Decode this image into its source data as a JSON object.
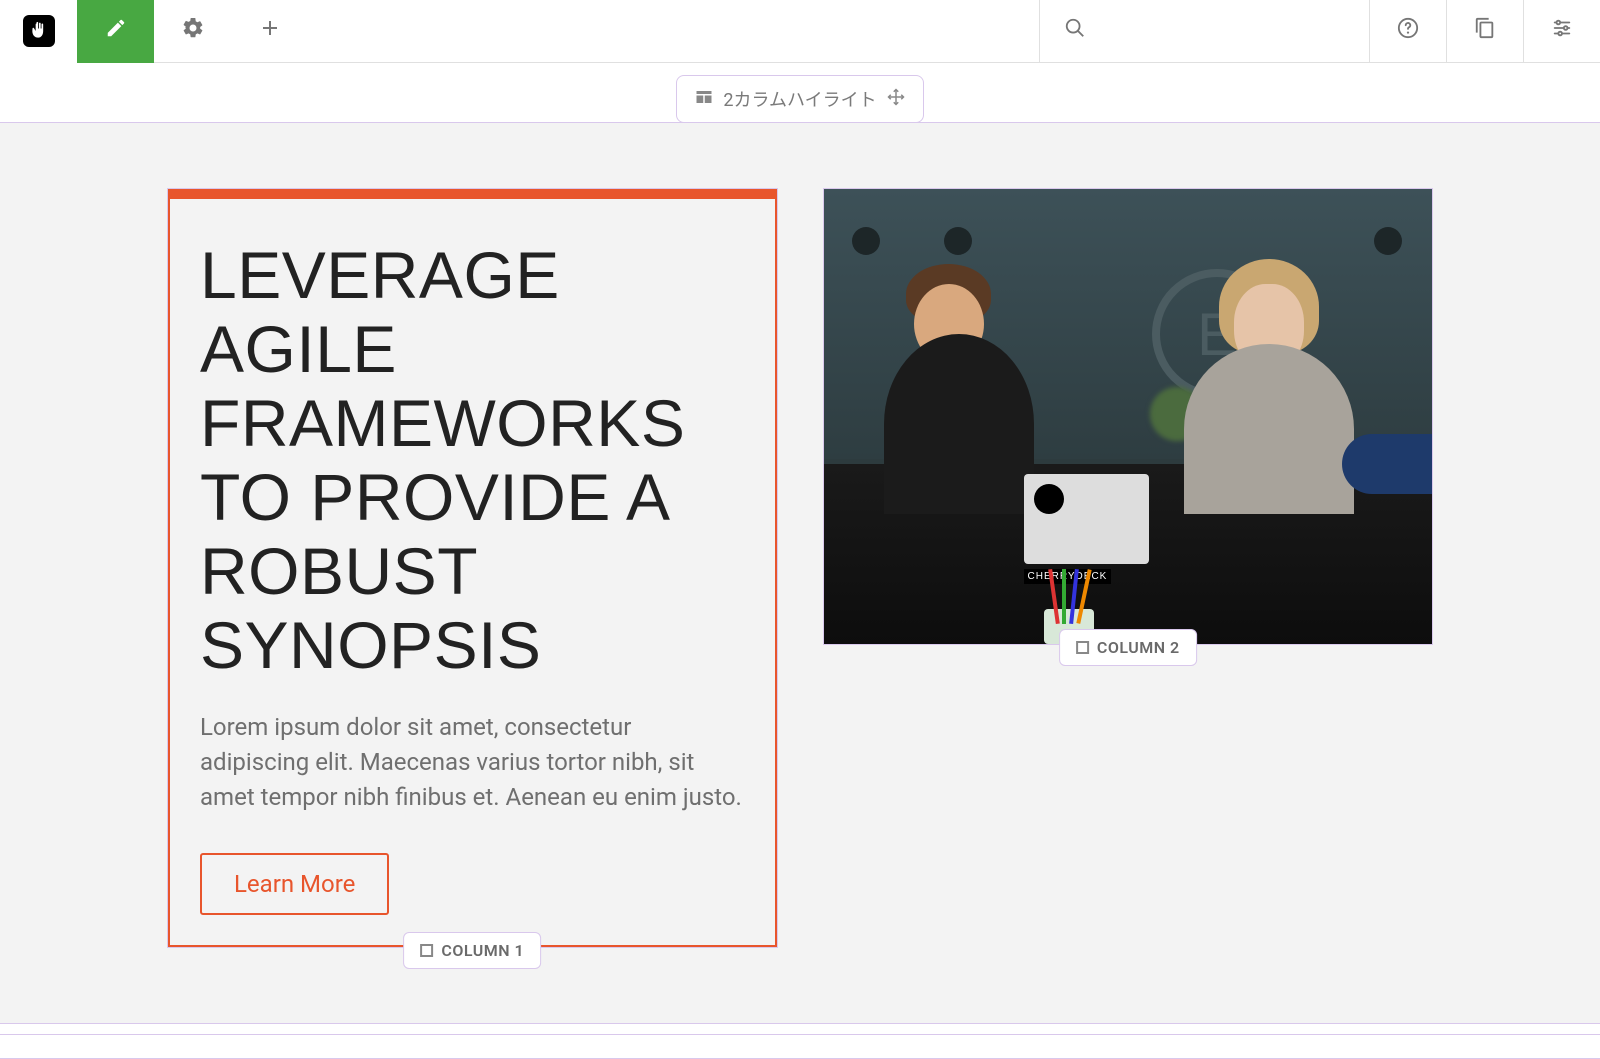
{
  "topbar": {
    "logo_label": "concrete5"
  },
  "block": {
    "type_label": "2カラムハイライト"
  },
  "columns": {
    "col1_badge": "COLUMN 1",
    "col2_badge": "COLUMN 2",
    "heading": "LEVERAGE AGILE FRAMEWORKS TO PROVIDE A ROBUST SYNOPSIS",
    "body": "Lorem ipsum dolor sit amet, consectetur adipiscing elit. Maecenas varius tortor nibh, sit amet tempor nibh finibus et. Aenean eu enim justo.",
    "cta_label": "Learn More"
  },
  "colors": {
    "accent": "#e8552c",
    "edit_active": "#48a842",
    "selection": "#d9c8ec"
  }
}
